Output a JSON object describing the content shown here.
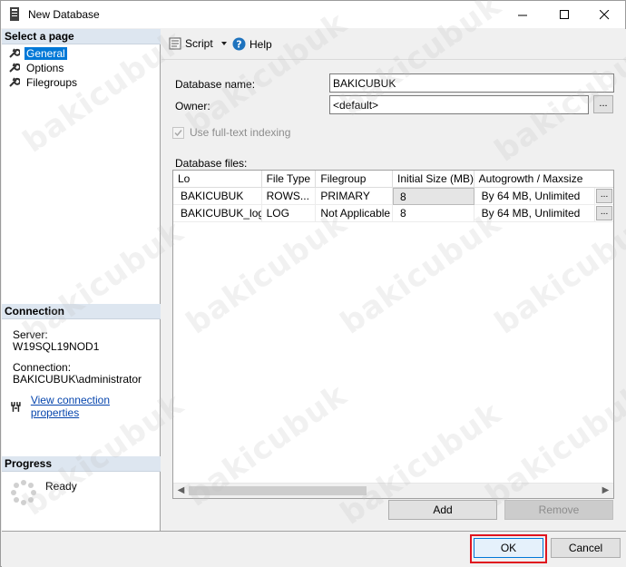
{
  "window": {
    "title": "New Database",
    "icon": "database-icon",
    "controls": {
      "minimize": "–",
      "maximize": "☐",
      "close": "✕"
    }
  },
  "left_panel": {
    "select_page_header": "Select a page",
    "pages": [
      {
        "label": "General",
        "selected": true,
        "icon": "wrench-icon"
      },
      {
        "label": "Options",
        "selected": false,
        "icon": "wrench-icon"
      },
      {
        "label": "Filegroups",
        "selected": false,
        "icon": "wrench-icon"
      }
    ],
    "connection_header": "Connection",
    "server_label": "Server:",
    "server_value": "W19SQL19NOD1",
    "connection_label": "Connection:",
    "connection_value": "BAKICUBUK\\administrator",
    "view_properties_link": "View connection properties",
    "progress_header": "Progress",
    "progress_status": "Ready"
  },
  "toolbar": {
    "script_label": "Script",
    "help_label": "Help"
  },
  "form": {
    "database_name_label": "Database name:",
    "database_name_value": "BAKICUBUK",
    "owner_label": "Owner:",
    "owner_value": "<default>",
    "owner_browse": "...",
    "fulltext_label": "Use full-text indexing",
    "fulltext_checked": true,
    "database_files_label": "Database files:"
  },
  "grid": {
    "columns": [
      "Lo",
      "File Type",
      "Filegroup",
      "Initial Size (MB)",
      "Autogrowth / Maxsize"
    ],
    "rows": [
      {
        "logical_name": "BAKICUBUK",
        "file_type": "ROWS...",
        "filegroup": "PRIMARY",
        "initial_size": "8",
        "autogrowth": "By 64 MB, Unlimited",
        "browse": "..."
      },
      {
        "logical_name": "BAKICUBUK_log",
        "file_type": "LOG",
        "filegroup": "Not Applicable",
        "initial_size": "8",
        "autogrowth": "By 64 MB, Unlimited",
        "browse": "..."
      }
    ]
  },
  "buttons": {
    "add": "Add",
    "remove": "Remove",
    "ok": "OK",
    "cancel": "Cancel"
  },
  "watermark": "bakicubuk",
  "colors": {
    "selection": "#0078d7",
    "highlight_frame": "#e0141e",
    "link": "#0645ad",
    "section_header": "#dde6f0"
  }
}
